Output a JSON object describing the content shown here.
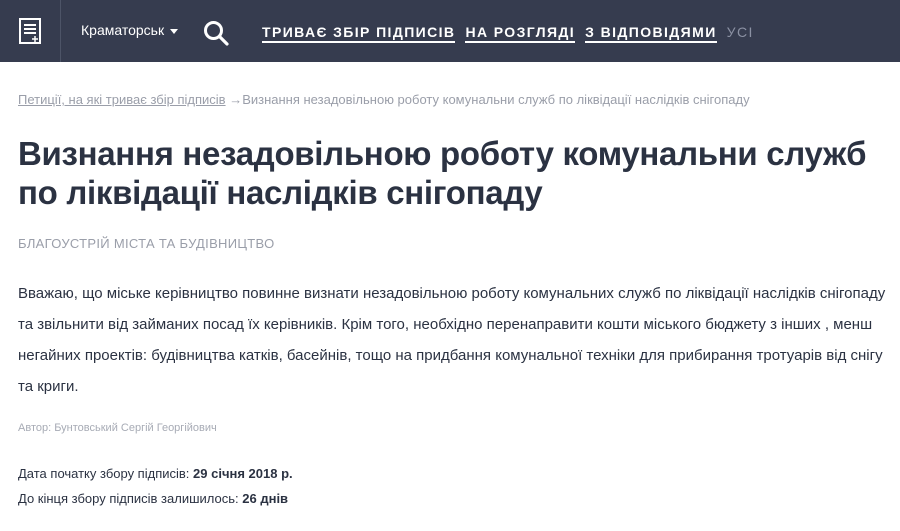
{
  "header": {
    "city": "Краматорськ",
    "nav": [
      {
        "label": "ТРИВАЄ ЗБІР ПІДПИСІВ"
      },
      {
        "label": "НА РОЗГЛЯДІ"
      },
      {
        "label": "З ВІДПОВІДЯМИ"
      },
      {
        "label": "УСІ"
      }
    ],
    "colors": {
      "bar": "#363c4f"
    }
  },
  "breadcrumb": {
    "link": "Петиції, на які триває збір підписів",
    "separator": "→",
    "current": "Визнання незадовільною роботу комунальни служб по ліквідації наслідків снігопаду"
  },
  "petition": {
    "title": "Визнання незадовільною роботу комунальни служб по ліквідації наслідків снігопаду",
    "category": "Благоустрій міста та будівництво",
    "text": "Вважаю, що міське керівництво повинне визнати незадовільною роботу комунальних служб по ліквідації наслідків снігопаду та звільнити від займаних посад їх керівників. Крім того, необхідно перенаправити кошти міського бюджету з інших , менш негайних проектів: будівництва катків, басейнів, тощо на придбання комунальної техніки для прибирання тротуарів від снігу та криги.",
    "author": "Автор: Бунтовський Сергій Георгійович",
    "start_label": "Дата початку збору підписів:",
    "start_value": "29 січня 2018 р.",
    "remaining_label": "До кінця збору підписів залишилось:",
    "remaining_value": "26 днів"
  }
}
